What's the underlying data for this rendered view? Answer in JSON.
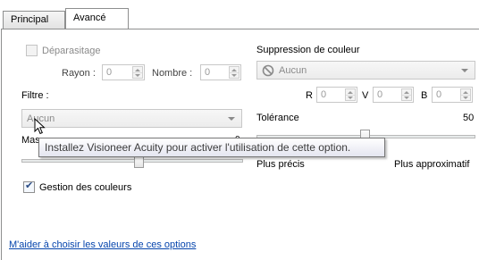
{
  "tabs": [
    {
      "label": "Principal",
      "active": false
    },
    {
      "label": "Avancé",
      "active": true
    }
  ],
  "left": {
    "deparasitage": {
      "label": "Déparasitage",
      "checked": false,
      "enabled": false
    },
    "rayon": {
      "label": "Rayon :",
      "value": "0"
    },
    "nombre": {
      "label": "Nombre :",
      "value": "0"
    },
    "filtre": {
      "label": "Filtre :",
      "value": "Aucun"
    },
    "masque": {
      "label": "Mas",
      "value": "0"
    },
    "gestion_couleurs": {
      "label": "Gestion des couleurs",
      "checked": true
    }
  },
  "right": {
    "suppression": {
      "label": "Suppression de couleur",
      "value": "Aucun",
      "icon": "no-entry-icon"
    },
    "r": {
      "label": "R",
      "value": "0"
    },
    "v": {
      "label": "V",
      "value": "0"
    },
    "b": {
      "label": "B",
      "value": "0"
    },
    "tolerance": {
      "label": "Tolérance",
      "value": "50"
    },
    "precision": {
      "left_label": "Plus précis",
      "right_label": "Plus approximatif"
    }
  },
  "tooltip": "Installez Visioneer Acuity pour activer l'utilisation de cette option.",
  "help_link": "M'aider à choisir les valeurs de ces options",
  "colors": {
    "link": "#0645ad",
    "disabled_text": "#8a8a8a",
    "check": "#2b4c85"
  }
}
